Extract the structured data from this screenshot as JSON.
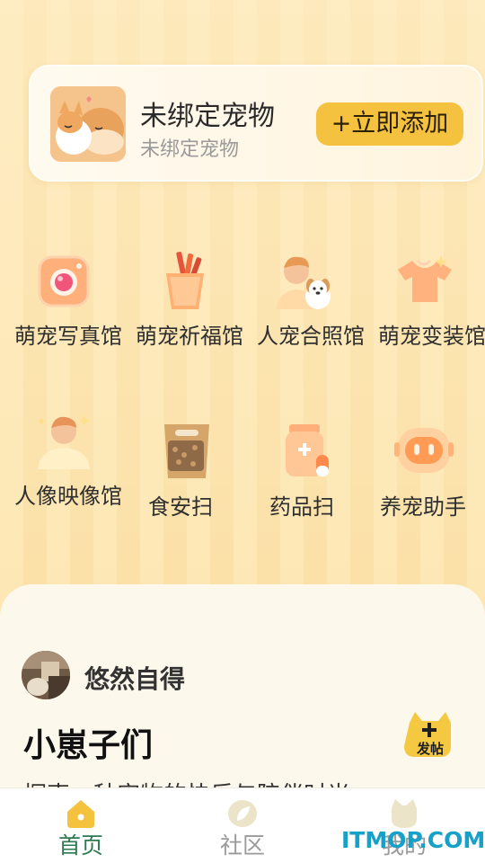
{
  "pet_card": {
    "title": "未绑定宠物",
    "subtitle": "未绑定宠物",
    "add_button": "+立即添加"
  },
  "grid": [
    {
      "label": "萌宠写真馆",
      "icon": "camera-icon"
    },
    {
      "label": "萌宠祈福馆",
      "icon": "incense-icon"
    },
    {
      "label": "人宠合照馆",
      "icon": "person-dog-icon"
    },
    {
      "label": "萌宠变装馆",
      "icon": "shirt-icon"
    },
    {
      "label": "人像映像馆",
      "icon": "person-icon"
    },
    {
      "label": "食安扫",
      "icon": "food-bag-icon"
    },
    {
      "label": "药品扫",
      "icon": "medicine-icon"
    },
    {
      "label": "养宠助手",
      "icon": "robot-icon"
    }
  ],
  "post": {
    "user_name": "悠然自得",
    "title": "小崽子们",
    "peek": "探索一种宠物的快乐与陪伴时光"
  },
  "fab": {
    "label": "发帖",
    "icon": "plus-icon"
  },
  "tabbar": [
    {
      "label": "首页",
      "icon": "home-icon",
      "active": true
    },
    {
      "label": "社区",
      "icon": "leaf-icon",
      "active": false
    },
    {
      "label": "我的",
      "icon": "cat-face-icon",
      "active": false
    }
  ],
  "watermark": "ITMOP.COM",
  "colors": {
    "accent": "#f4c23e",
    "active_tab": "#2c7a4f",
    "inactive_tab": "#9a9a9a",
    "background": "#fde7b4"
  }
}
